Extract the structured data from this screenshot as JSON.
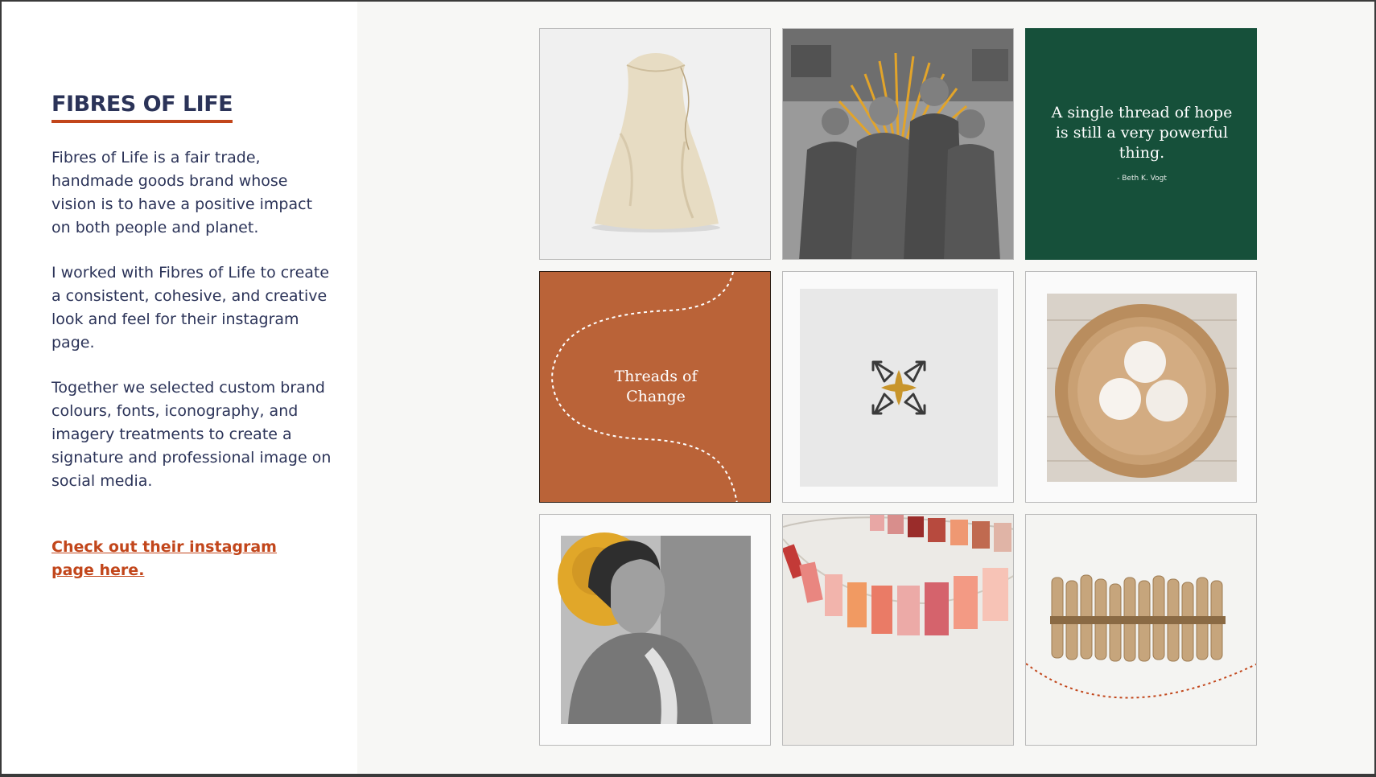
{
  "sidebar": {
    "title": "FIBRES OF LIFE",
    "paragraphs": [
      "Fibres of Life is a fair trade, handmade goods brand whose vision is to have a positive impact on both people and planet.",
      "I worked with Fibres of Life to create a consistent, cohesive, and creative look and feel for their instagram page.",
      "Together we selected custom brand colours, fonts, iconography, and imagery treatments to create a signature and professional image on social media."
    ],
    "cta_label": "Check out their instagram page here."
  },
  "grid": {
    "tiles": [
      {
        "name": "drawstring-bag-photo",
        "kind": "photo"
      },
      {
        "name": "artisan-women-photo",
        "kind": "photo"
      },
      {
        "name": "quote-tile",
        "kind": "text",
        "quote": "A single thread of hope is still a very powerful thing.",
        "attribution": "- Beth K. Vogt"
      },
      {
        "name": "threads-of-change-tile",
        "kind": "text",
        "text": "Threads of Change"
      },
      {
        "name": "brand-logo-tile",
        "kind": "logo"
      },
      {
        "name": "wool-dryer-balls-photo",
        "kind": "photo"
      },
      {
        "name": "artisan-portrait-photo",
        "kind": "photo"
      },
      {
        "name": "fabric-bunting-photo",
        "kind": "photo"
      },
      {
        "name": "wooden-clothespins-photo",
        "kind": "photo"
      }
    ]
  },
  "colors": {
    "navy": "#2b3358",
    "accent_orange": "#c2461b",
    "terracotta": "#ba6338",
    "forest_green": "#16503a",
    "gold": "#e5a823"
  }
}
